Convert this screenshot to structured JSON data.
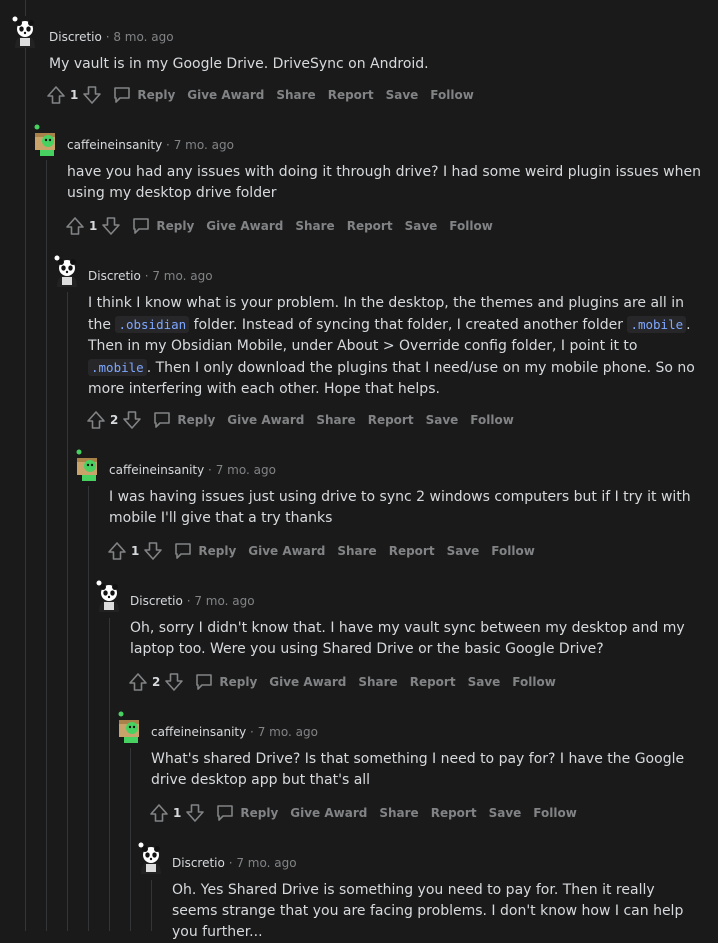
{
  "labels": {
    "reply": "Reply",
    "give_award": "Give Award",
    "share": "Share",
    "report": "Report",
    "save": "Save",
    "follow": "Follow",
    "separator": "·"
  },
  "comments": [
    {
      "username": "Discretio",
      "time": "8 mo. ago",
      "votes": "1",
      "body": "My vault is in my Google Drive. DriveSync on Android."
    },
    {
      "username": "caffeineinsanity",
      "time": "7 mo. ago",
      "votes": "1",
      "body": "have you had any issues with doing it through drive? I had some weird plugin issues when using my desktop drive folder"
    },
    {
      "username": "Discretio",
      "time": "7 mo. ago",
      "votes": "2",
      "body_parts": [
        "I think I know what is your problem. In the desktop, the themes and plugins are all in the ",
        ".obsidian",
        " folder. Instead of syncing that folder, I created another folder ",
        ".mobile",
        ". Then in my Obsidian Mobile, under About > Override config folder, I point it to ",
        ".mobile",
        ". Then I only download the plugins that I need/use on my mobile phone. So no more interfering with each other. Hope that helps."
      ]
    },
    {
      "username": "caffeineinsanity",
      "time": "7 mo. ago",
      "votes": "1",
      "body": "I was having issues just using drive to sync 2 windows computers but if I try it with mobile I'll give that a try thanks"
    },
    {
      "username": "Discretio",
      "time": "7 mo. ago",
      "votes": "2",
      "body": "Oh, sorry I didn't know that. I have my vault sync between my desktop and my laptop too. Were you using Shared Drive or the basic Google Drive?"
    },
    {
      "username": "caffeineinsanity",
      "time": "7 mo. ago",
      "votes": "1",
      "body": "What's shared Drive? Is that something I need to pay for? I have the Google drive desktop app but that's all"
    },
    {
      "username": "Discretio",
      "time": "7 mo. ago",
      "body": "Oh. Yes Shared Drive is something you need to pay for. Then it really seems strange that you are facing problems. I don't know how I can help you further..."
    }
  ]
}
